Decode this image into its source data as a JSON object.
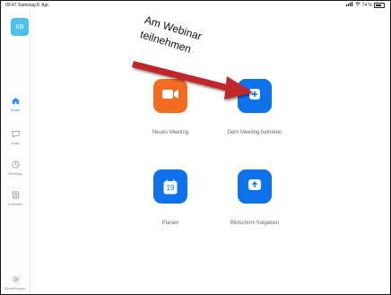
{
  "status_bar": {
    "time": "09:47",
    "date": "Samstag 8. Apr.",
    "battery": "74 %"
  },
  "sidebar": {
    "avatar_initials": "KB",
    "items": [
      {
        "label": "Home",
        "icon": "home-icon",
        "active": true
      },
      {
        "label": "Chats",
        "icon": "chat-icon",
        "active": false
      },
      {
        "label": "Meetings",
        "icon": "clock-icon",
        "active": false
      },
      {
        "label": "Kontakte",
        "icon": "contacts-icon",
        "active": false
      }
    ],
    "settings_label": "Einstellungen"
  },
  "actions": {
    "new_meeting": "Neues Meeting",
    "join_meeting": "Dem Meeting beitreten",
    "schedule": "Planen",
    "calendar_day": "19",
    "share_screen": "Bildschirm freigeben"
  },
  "annotation": {
    "line1": "Am Webinar",
    "line2": "teilnehmen"
  },
  "colors": {
    "orange": "#f26d21",
    "blue": "#0e72ed",
    "accent": "#2d8cff",
    "arrow": "#c0262a"
  }
}
